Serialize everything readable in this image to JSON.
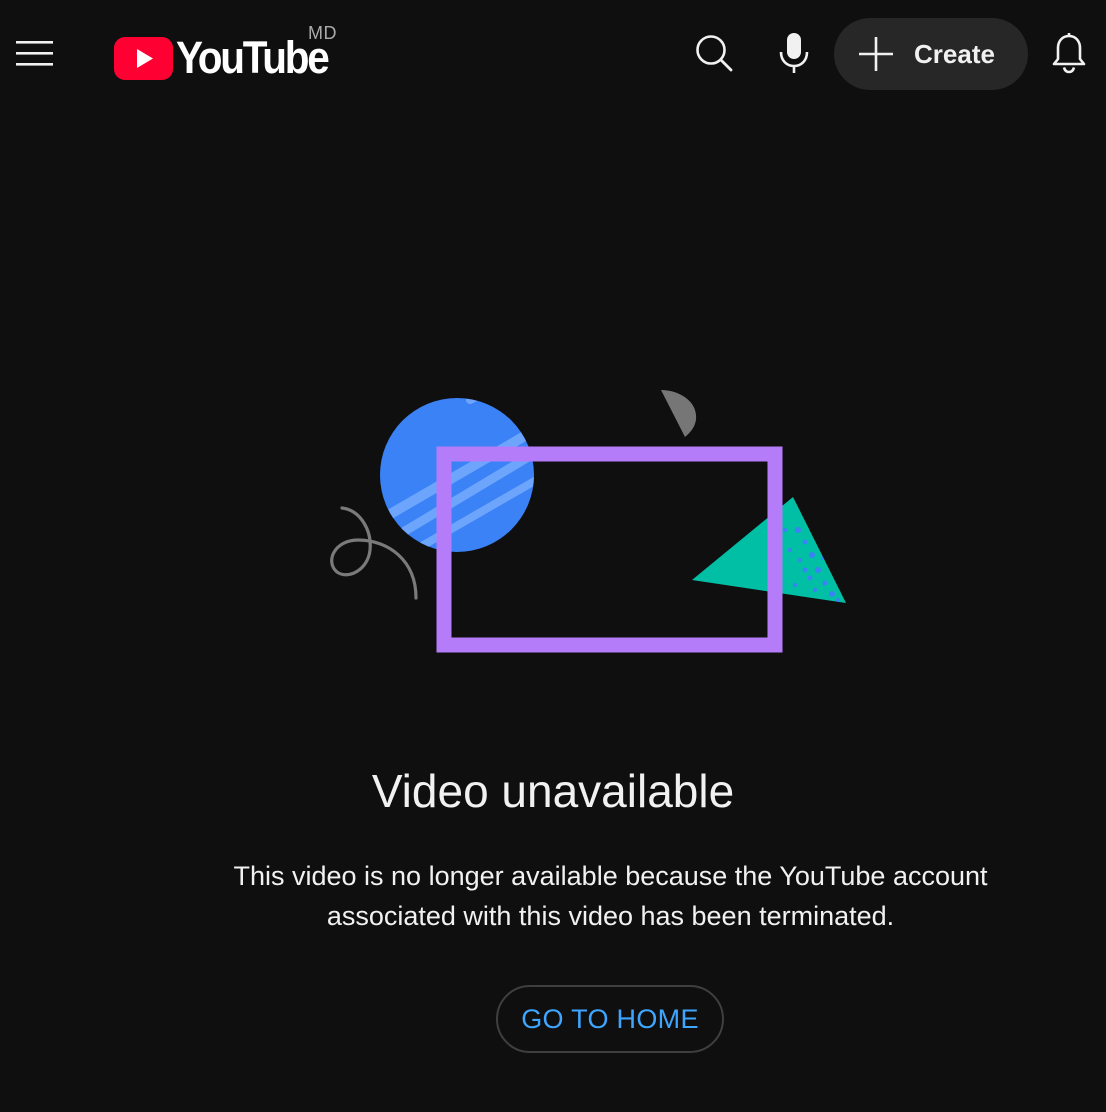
{
  "header": {
    "menu_icon": "hamburger-menu-icon",
    "logo_text": "YouTube",
    "country_code": "MD",
    "search_icon": "search-icon",
    "mic_icon": "microphone-icon",
    "create_label": "Create",
    "create_icon": "plus-icon",
    "notifications_icon": "bell-icon"
  },
  "main": {
    "title": "Video unavailable",
    "message": "This video is no longer available because the YouTube account associated with this video has been terminated.",
    "button_label": "GO TO HOME"
  },
  "colors": {
    "background": "#0f0f0f",
    "brand_red": "#ff0033",
    "link_blue": "#3ea6ff",
    "frame_purple": "#b57cfa",
    "circle_blue": "#3b82f6",
    "triangle_teal": "#00bfa5"
  }
}
